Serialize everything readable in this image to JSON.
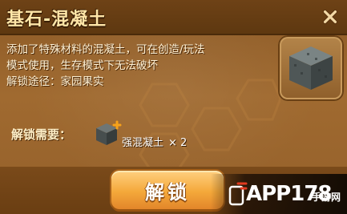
{
  "dialog": {
    "title": "基石-混凝土",
    "description_lines": [
      "添加了特殊材料的混凝土，可在创造/玩法",
      "模式使用，生存模式下无法破坏",
      "解锁途径：家园果实"
    ],
    "item_icon": "concrete-block-icon",
    "close_icon": "close-icon"
  },
  "requirements": {
    "label": "解锁需要：",
    "material": {
      "icon": "reinforced-concrete-icon",
      "name": "强混凝土",
      "count": "× 2"
    }
  },
  "actions": {
    "unlock_label": "解锁"
  },
  "watermark": {
    "logo_text": "APP178",
    "sub_text": "手游网"
  },
  "colors": {
    "title_text": "#ffe6a8",
    "button_orange": "#f4a83a",
    "panel_brown": "#a06a30"
  }
}
